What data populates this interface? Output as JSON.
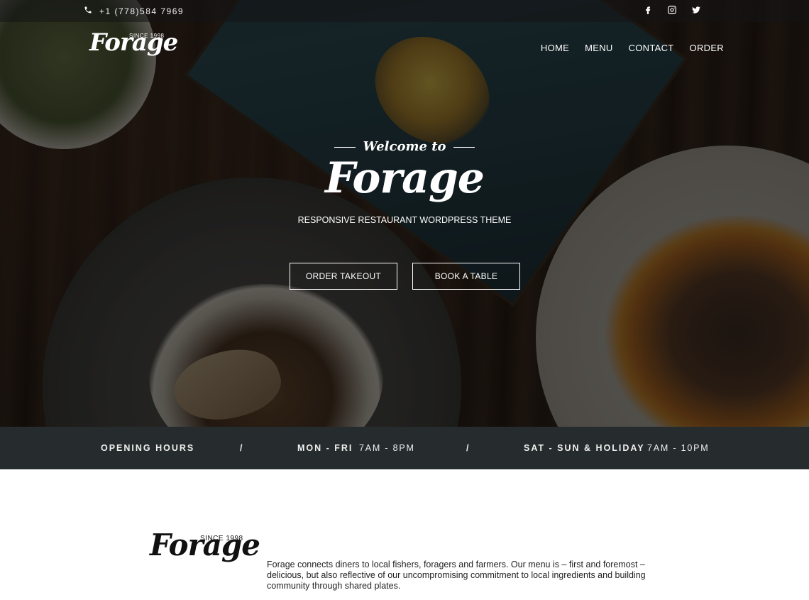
{
  "topbar": {
    "phone": "+1 (778)584 7969",
    "social": [
      "facebook-icon",
      "instagram-icon",
      "twitter-icon"
    ]
  },
  "brand": {
    "logo_word": "Forage",
    "since": "SINCE 1998"
  },
  "nav": {
    "items": [
      "HOME",
      "MENU",
      "CONTACT",
      "ORDER"
    ]
  },
  "hero": {
    "welcome": "Welcome to",
    "title": "Forage",
    "tagline": "RESPONSIVE RESTAURANT WORDPRESS THEME",
    "buttons": [
      "ORDER TAKEOUT",
      "BOOK A TABLE"
    ]
  },
  "hours": {
    "label": "OPENING HOURS",
    "sep": "/",
    "weekday_label": "MON - FRI",
    "weekday_time": "7AM - 8PM",
    "weekend_label": "SAT - SUN & HOLIDAY",
    "weekend_time": "7AM - 10PM"
  },
  "about": {
    "logo_word": "Forage",
    "since": "SINCE 1998",
    "text": "Forage connects diners to local fishers, foragers and farmers. Our menu is – first and foremost – delicious, but also reflective of our uncompromising commitment to local ingredients and building community through shared plates."
  }
}
